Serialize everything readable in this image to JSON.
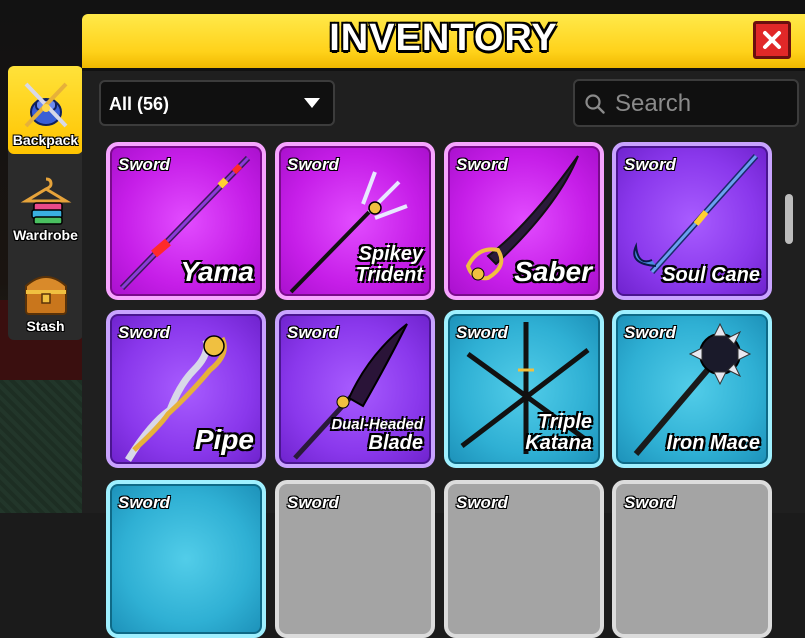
{
  "sidebar": {
    "tabs": [
      {
        "label": "Backpack",
        "icon": "backpack-icon"
      },
      {
        "label": "Wardrobe",
        "icon": "wardrobe-icon"
      },
      {
        "label": "Stash",
        "icon": "treasure-chest-icon"
      }
    ]
  },
  "panel": {
    "title": "INVENTORY",
    "close_icon": "close-icon"
  },
  "filter": {
    "selected": "All (56)"
  },
  "search": {
    "placeholder": "Search",
    "value": ""
  },
  "items": [
    {
      "category": "Sword",
      "name": "Yama",
      "rarity_color": "#c61ee8"
    },
    {
      "category": "Sword",
      "name_line1": "Spikey",
      "name_line2": "Trident",
      "rarity_color": "#c61ee8"
    },
    {
      "category": "Sword",
      "name": "Saber",
      "rarity_color": "#c61ee8"
    },
    {
      "category": "Sword",
      "name": "Soul Cane",
      "rarity_color": "#8a38ec"
    },
    {
      "category": "Sword",
      "name": "Pipe",
      "rarity_color": "#8a38ec"
    },
    {
      "category": "Sword",
      "name_line1": "Dual-Headed",
      "name_line2": "Blade",
      "rarity_color": "#8a38ec"
    },
    {
      "category": "Sword",
      "name_line1": "Triple",
      "name_line2": "Katana",
      "rarity_color": "#2fb0d4"
    },
    {
      "category": "Sword",
      "name": "Iron Mace",
      "rarity_color": "#2fb0d4"
    },
    {
      "category": "Sword",
      "rarity_color": "#2fb0d4"
    },
    {
      "category": "Sword",
      "rarity_color": "#a4a4a4"
    },
    {
      "category": "Sword",
      "rarity_color": "#a4a4a4"
    },
    {
      "category": "Sword",
      "rarity_color": "#a4a4a4"
    }
  ]
}
